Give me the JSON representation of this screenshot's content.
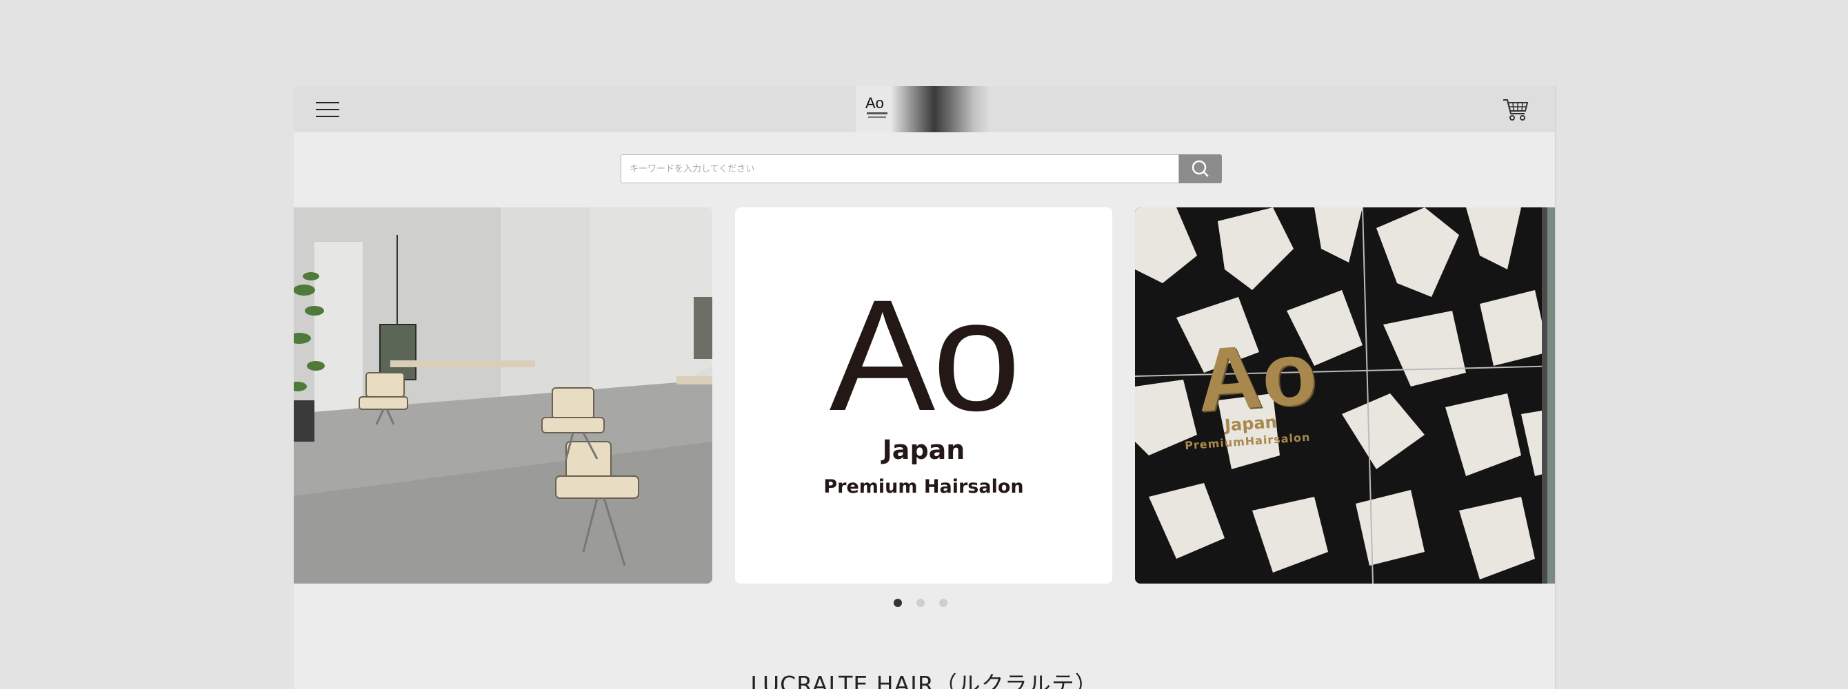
{
  "header": {
    "menu_icon": "hamburger-menu-icon",
    "logo_text": "Ao",
    "cart_icon": "shopping-cart-icon"
  },
  "search": {
    "placeholder": "キーワードを入力してください",
    "value": "",
    "button_icon": "search-icon"
  },
  "carousel": {
    "slides": [
      {
        "kind": "photo",
        "subject": "salon-interior"
      },
      {
        "kind": "logo",
        "logo": "Ao",
        "line1": "Japan",
        "line2": "Premium Hairsalon"
      },
      {
        "kind": "photo",
        "subject": "marble-wall-sign",
        "logo": "Ao",
        "line1": "Japan",
        "line2": "PremiumHairsalon"
      }
    ],
    "active_index": 0,
    "dot_count": 3
  },
  "shop": {
    "title": "LUCRALTE HAIR（ルクラルテ）"
  },
  "colors": {
    "background": "#e3e3e3",
    "page": "#ececec",
    "header": "#dedede",
    "search_button": "#8c8c8c",
    "logo_dark": "#231815",
    "gold": "#a8884d"
  }
}
